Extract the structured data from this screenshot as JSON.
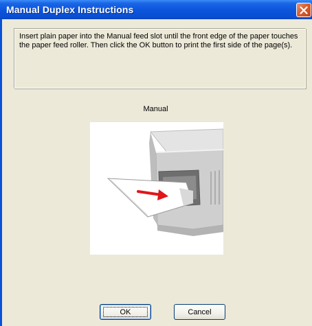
{
  "window": {
    "title": "Manual Duplex Instructions",
    "close_icon": "close-icon"
  },
  "instructions": {
    "text": "Insert plain paper into the Manual feed slot until the front edge of the paper touches the paper feed roller. Then click the OK button to print the first side of the page(s)."
  },
  "illustration": {
    "caption": "Manual",
    "image": "printer-manual-feed-illustration"
  },
  "buttons": {
    "ok_label": "OK",
    "cancel_label": "Cancel"
  },
  "colors": {
    "titlebar": "#0a51d6",
    "dialog_background": "#ece9d8",
    "close_button": "#d9602f",
    "arrow": "#e0161c"
  }
}
